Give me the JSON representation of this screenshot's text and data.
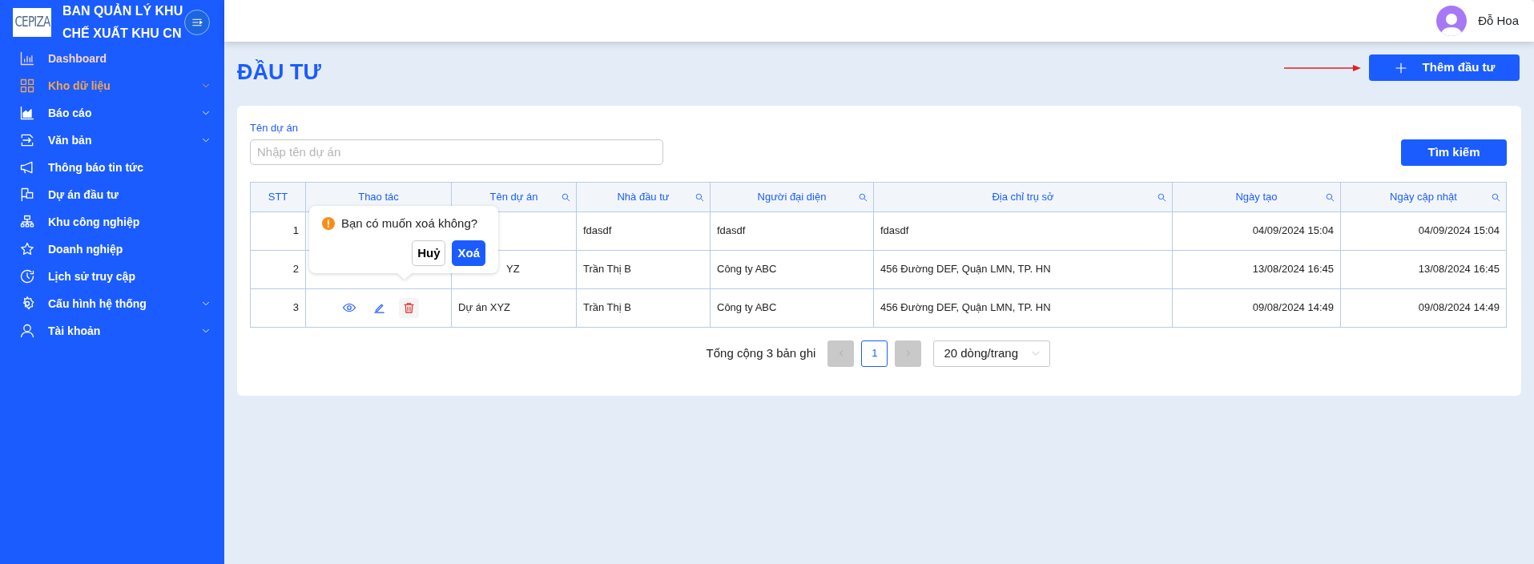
{
  "sidebar": {
    "title_lines": [
      "BAN QUẢN LÝ KHU",
      "CHẾ XUẤT KHU CN"
    ],
    "logo": "CEPIZA",
    "items": [
      {
        "label": "Dashboard",
        "selected": false,
        "hovered": true,
        "expandable": false
      },
      {
        "label": "Kho dữ liệu",
        "selected": true,
        "hovered": false,
        "expandable": true
      },
      {
        "label": "Báo cáo",
        "selected": false,
        "hovered": false,
        "expandable": true
      },
      {
        "label": "Văn bản",
        "selected": false,
        "hovered": false,
        "expandable": true
      },
      {
        "label": "Thông báo tin tức",
        "selected": false,
        "hovered": false,
        "expandable": false
      },
      {
        "label": "Dự án đầu tư",
        "selected": false,
        "hovered": false,
        "expandable": false
      },
      {
        "label": "Khu công nghiệp",
        "selected": false,
        "hovered": false,
        "expandable": false
      },
      {
        "label": "Doanh nghiệp",
        "selected": false,
        "hovered": false,
        "expandable": false
      },
      {
        "label": "Lịch sử truy cập",
        "selected": false,
        "hovered": false,
        "expandable": false
      },
      {
        "label": "Cấu hình hệ thống",
        "selected": false,
        "hovered": false,
        "expandable": true
      },
      {
        "label": "Tài khoản",
        "selected": false,
        "hovered": false,
        "expandable": true
      }
    ]
  },
  "header": {
    "user_name": "Đỗ Hoa"
  },
  "page": {
    "title": "ĐẦU TƯ",
    "add_button": "Thêm đầu tư"
  },
  "filter": {
    "label": "Tên dự án",
    "placeholder": "Nhập tên dự án",
    "search_button": "Tìm kiếm"
  },
  "table": {
    "columns": [
      {
        "label": "STT",
        "searchable": false
      },
      {
        "label": "Thao tác",
        "searchable": false
      },
      {
        "label": "Tên dự án",
        "searchable": true
      },
      {
        "label": "Nhà đầu tư",
        "searchable": true
      },
      {
        "label": "Người đại diện",
        "searchable": true
      },
      {
        "label": "Địa chỉ trụ sở",
        "searchable": true
      },
      {
        "label": "Ngày tạo",
        "searchable": true
      },
      {
        "label": "Ngày cập nhật",
        "searchable": true
      }
    ],
    "rows": [
      {
        "stt": "1",
        "investor": "fdasdf",
        "representative": "fdasdf",
        "address": "fdasdf",
        "created": "04/09/2024 15:04",
        "updated": "04/09/2024 15:04"
      },
      {
        "stt": "2",
        "name": "YZ",
        "investor": "Trần Thị B",
        "representative": "Công ty ABC",
        "address": "456 Đường DEF, Quận LMN, TP. HN",
        "created": "13/08/2024 16:45",
        "updated": "13/08/2024 16:45"
      },
      {
        "stt": "3",
        "actions_visible": true,
        "name": "Dự án XYZ",
        "investor": "Trần Thị B",
        "representative": "Công ty ABC",
        "address": "456 Đường DEF, Quận LMN, TP. HN",
        "created": "09/08/2024 14:49",
        "updated": "09/08/2024 14:49"
      }
    ]
  },
  "popconfirm": {
    "message": "Bạn có muốn xoá không?",
    "cancel": "Huỷ",
    "confirm": "Xoá"
  },
  "pagination": {
    "total": "Tổng cộng 3 bản ghi",
    "pages": [
      {
        "label": "1",
        "selected": true
      }
    ],
    "page_size": "20 dòng/trang"
  }
}
